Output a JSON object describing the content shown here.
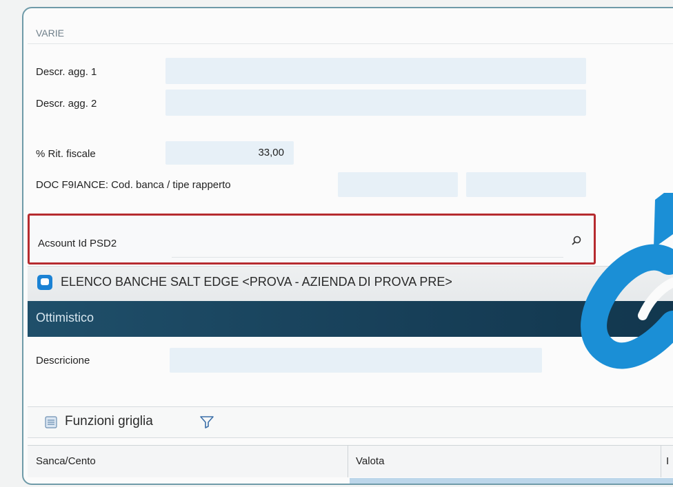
{
  "section": {
    "title": "VARIE"
  },
  "fields": {
    "descr1_label": "Descr. agg. 1",
    "descr2_label": "Descr. agg. 2",
    "rit_label": "% Rit. fiscale",
    "rit_value": "33,00",
    "doc_label": "DOC F9IANCE: Cod. banca / tipe rapperto",
    "account_label": "Acsount Id PSD2"
  },
  "panel": {
    "title": "ELENCO BANCHE SALT EDGE <PROVA - AZIENDA DI PROVA PRE>",
    "bar_label": "Ottimistico",
    "descr_label": "Descricione"
  },
  "toolbar": {
    "functions_label": "Funzioni griglia"
  },
  "grid": {
    "columns": [
      "Sanca/Cento",
      "Valota",
      "I"
    ]
  },
  "icons": {
    "search": "search-icon",
    "window": "window-icon",
    "grid_functions": "grid-functions-icon",
    "filter": "filter-icon",
    "logo": "link-logo"
  },
  "colors": {
    "accent_blue": "#1b82d4",
    "highlight_red": "#b62b2f",
    "bar_dark": "#173f58"
  }
}
